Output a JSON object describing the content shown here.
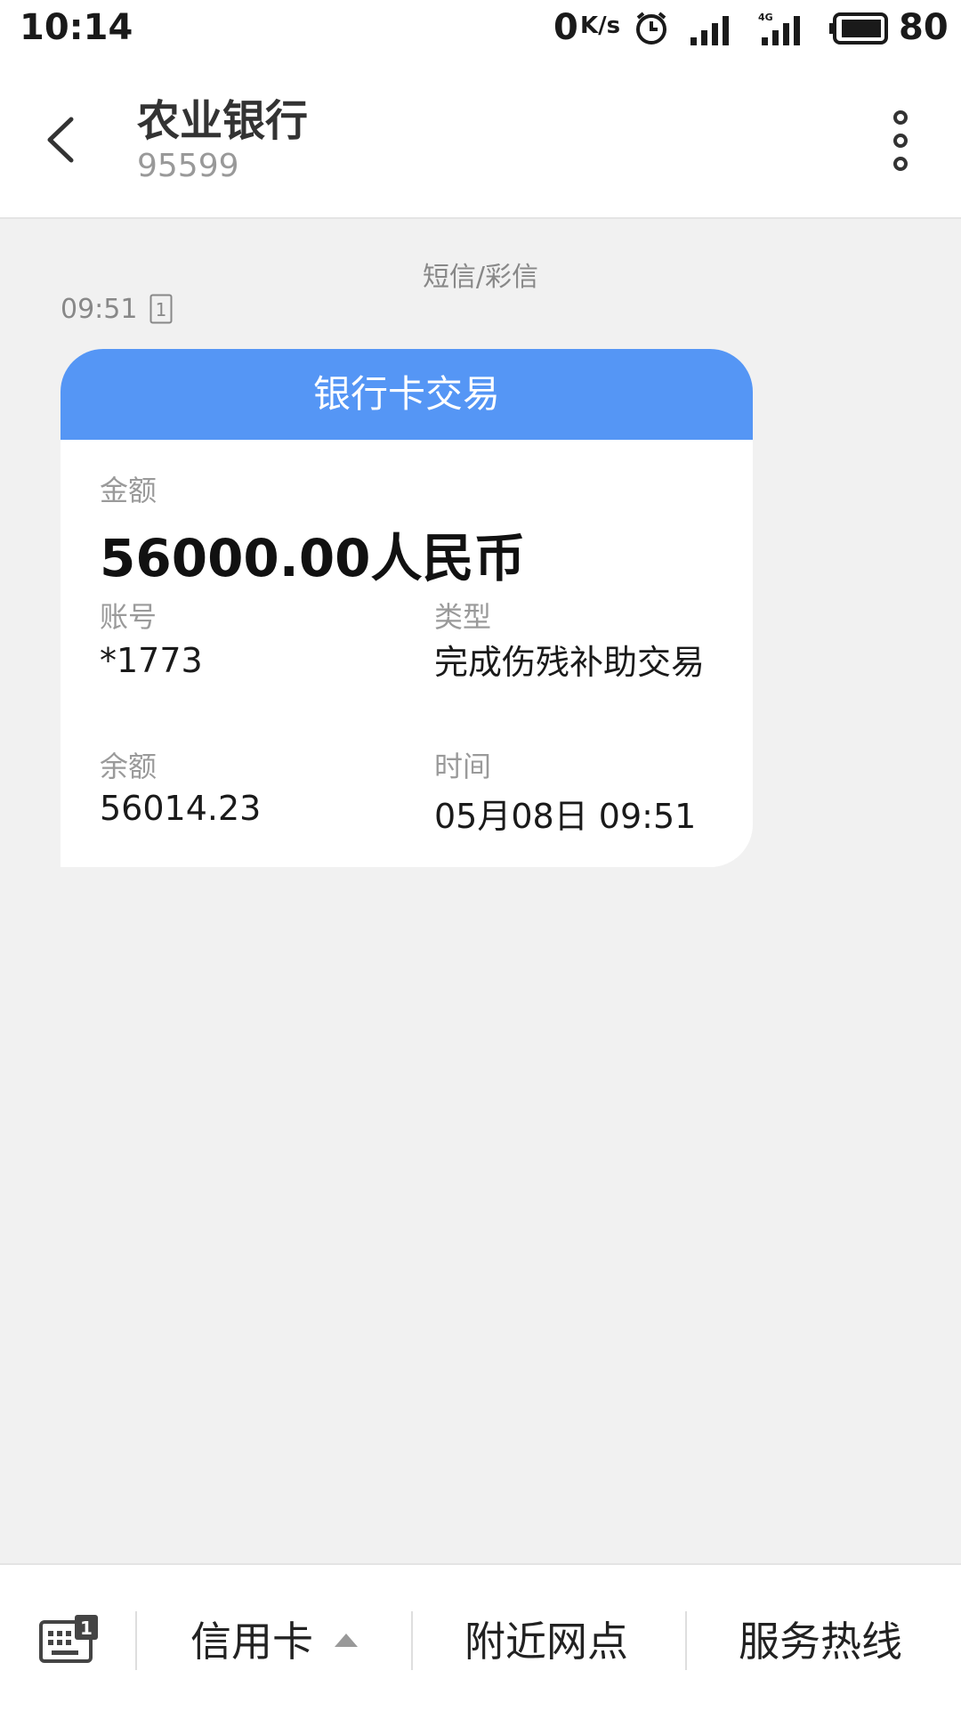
{
  "status_bar": {
    "time": "10:14",
    "net_speed": "0",
    "net_speed_unit": "K/s",
    "battery": "80",
    "icons": [
      "alarm-icon",
      "signal-icon",
      "signal-4g-icon",
      "battery-icon"
    ]
  },
  "header": {
    "title": "农业银行",
    "subtitle": "95599",
    "icons": [
      "back-arrow-icon",
      "more-vertical-icon"
    ]
  },
  "conversation": {
    "message_type": "短信/彩信",
    "time": "09:51",
    "sim_slot": "1",
    "card": {
      "title": "银行卡交易",
      "amount_label": "金额",
      "amount": "56000.00人民币",
      "account_label": "账号",
      "account": "*1773",
      "type_label": "类型",
      "type_value": "完成伤残补助交易",
      "balance_label": "余额",
      "balance": "56014.23",
      "time_label": "时间",
      "time": "05月08日 09:51"
    }
  },
  "bottom_bar": {
    "keyboard_badge": "1",
    "items": [
      "信用卡",
      "附近网点",
      "服务热线"
    ]
  },
  "colors": {
    "card_header": "#5596f5",
    "background": "#f1f1f1"
  }
}
